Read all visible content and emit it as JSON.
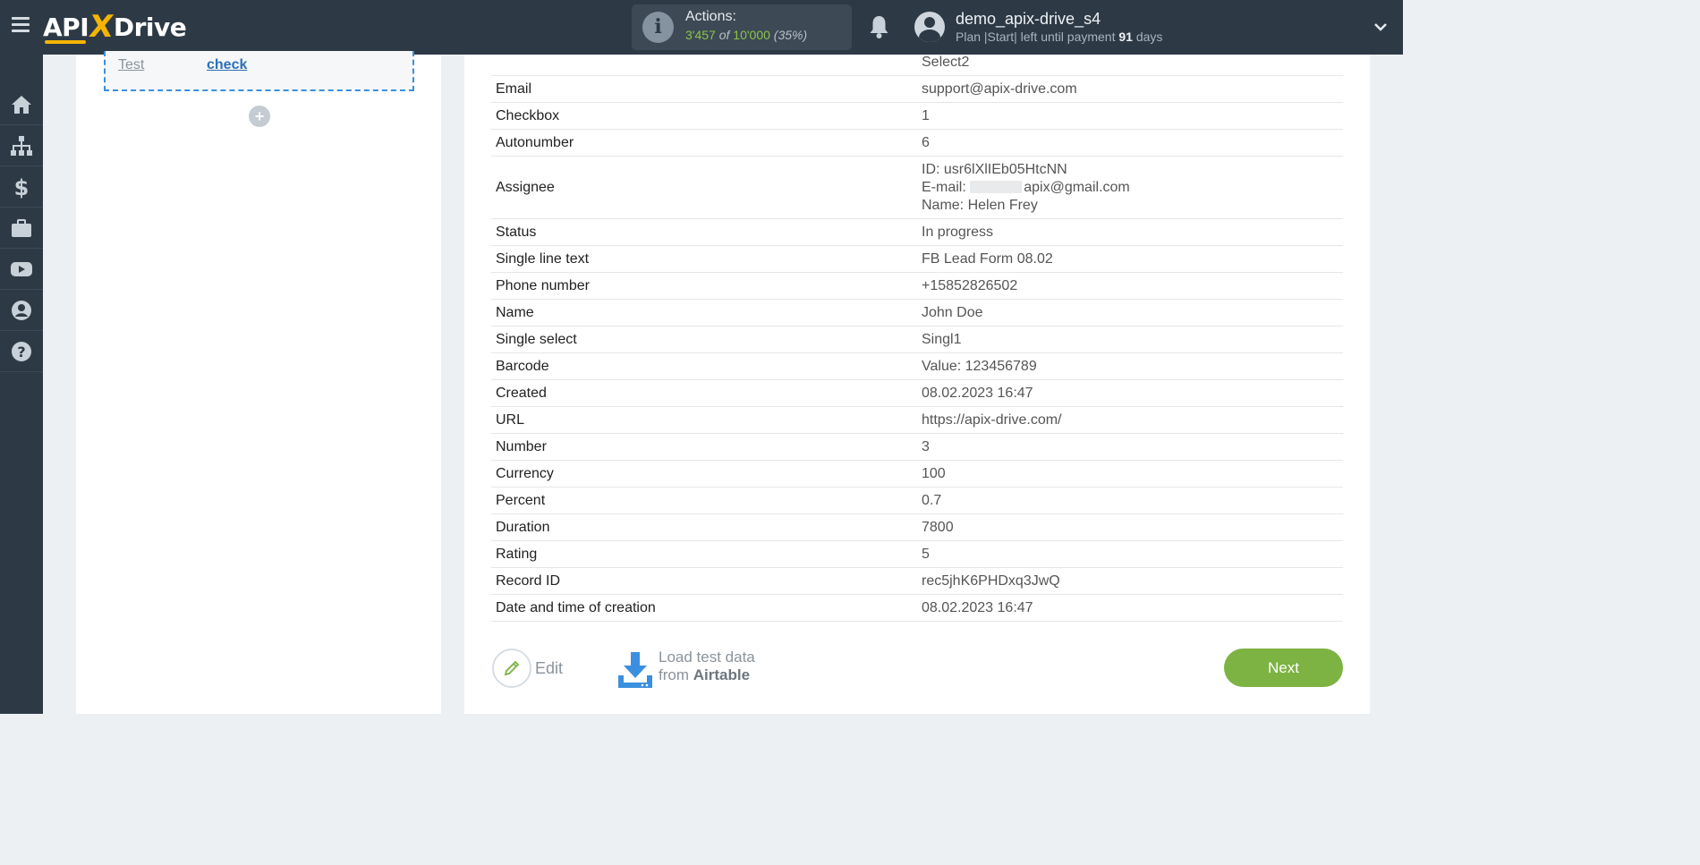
{
  "header": {
    "logo": {
      "prefix": "API",
      "x": "X",
      "suffix": "Drive"
    },
    "actions": {
      "label": "Actions:",
      "used": "3'457",
      "of": "of",
      "total": "10'000",
      "percent": "(35%)"
    },
    "user": {
      "name": "demo_apix-drive_s4",
      "plan_prefix": "Plan |Start| left until payment",
      "days": "91",
      "days_suffix": "days"
    }
  },
  "sidebar": {
    "items": [
      {
        "icon": "home-icon"
      },
      {
        "icon": "sitemap-icon"
      },
      {
        "icon": "dollar-icon"
      },
      {
        "icon": "briefcase-icon"
      },
      {
        "icon": "youtube-icon"
      },
      {
        "icon": "user-circle-icon"
      },
      {
        "icon": "help-icon"
      }
    ]
  },
  "left_panel": {
    "test_label": "Test",
    "check_link": "check",
    "add_button": "+"
  },
  "right_panel": {
    "top_value": "Select2",
    "rows": [
      {
        "key": "Email",
        "value": "support@apix-drive.com"
      },
      {
        "key": "Checkbox",
        "value": "1"
      },
      {
        "key": "Autonumber",
        "value": "6"
      },
      {
        "key": "Assignee",
        "value_lines": [
          "ID: usr6lXlIEb05HtcNN",
          "E-mail:",
          "apix@gmail.com",
          "Name: Helen Frey"
        ]
      },
      {
        "key": "Status",
        "value": "In progress"
      },
      {
        "key": "Single line text",
        "value": "FB Lead Form 08.02"
      },
      {
        "key": "Phone number",
        "value": "+15852826502"
      },
      {
        "key": "Name",
        "value": "John Doe"
      },
      {
        "key": "Single select",
        "value": "Singl1"
      },
      {
        "key": "Barcode",
        "value": "Value: 123456789"
      },
      {
        "key": "Created",
        "value": "08.02.2023 16:47"
      },
      {
        "key": "URL",
        "value": "https://apix-drive.com/"
      },
      {
        "key": "Number",
        "value": "3"
      },
      {
        "key": "Currency",
        "value": "100"
      },
      {
        "key": "Percent",
        "value": "0.7"
      },
      {
        "key": "Duration",
        "value": "7800"
      },
      {
        "key": "Rating",
        "value": "5"
      },
      {
        "key": "Record ID",
        "value": "rec5jhK6PHDxq3JwQ"
      },
      {
        "key": "Date and time of creation",
        "value": "08.02.2023 16:47"
      }
    ],
    "edit_label": "Edit",
    "load_line1": "Load test data",
    "load_line2_prefix": "from",
    "load_source": "Airtable",
    "next_label": "Next"
  },
  "colors": {
    "topbar": "#2d3a46",
    "accent_green": "#7cb342",
    "link_blue": "#2b6fb8"
  }
}
